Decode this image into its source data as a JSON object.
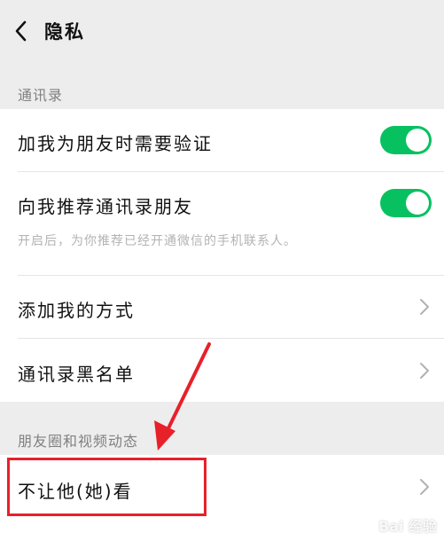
{
  "header": {
    "title": "隐私",
    "back_icon": "chevron-left-icon"
  },
  "contacts_section": {
    "title": "通讯录",
    "verify_label": "加我为朋友时需要验证",
    "verify_on": true,
    "recommend_label": "向我推荐通讯录朋友",
    "recommend_on": true,
    "recommend_desc": "开启后，为你推荐已经开通微信的手机联系人。",
    "add_methods_label": "添加我的方式",
    "blacklist_label": "通讯录黑名单"
  },
  "moments_section": {
    "title": "朋友圈和视频动态",
    "hide_from_label": "不让他(她)看"
  },
  "annotation": {
    "color": "#e8202a"
  },
  "watermark": "Bai 经验",
  "colors": {
    "accent": "#07c160",
    "background": "#ededed"
  }
}
